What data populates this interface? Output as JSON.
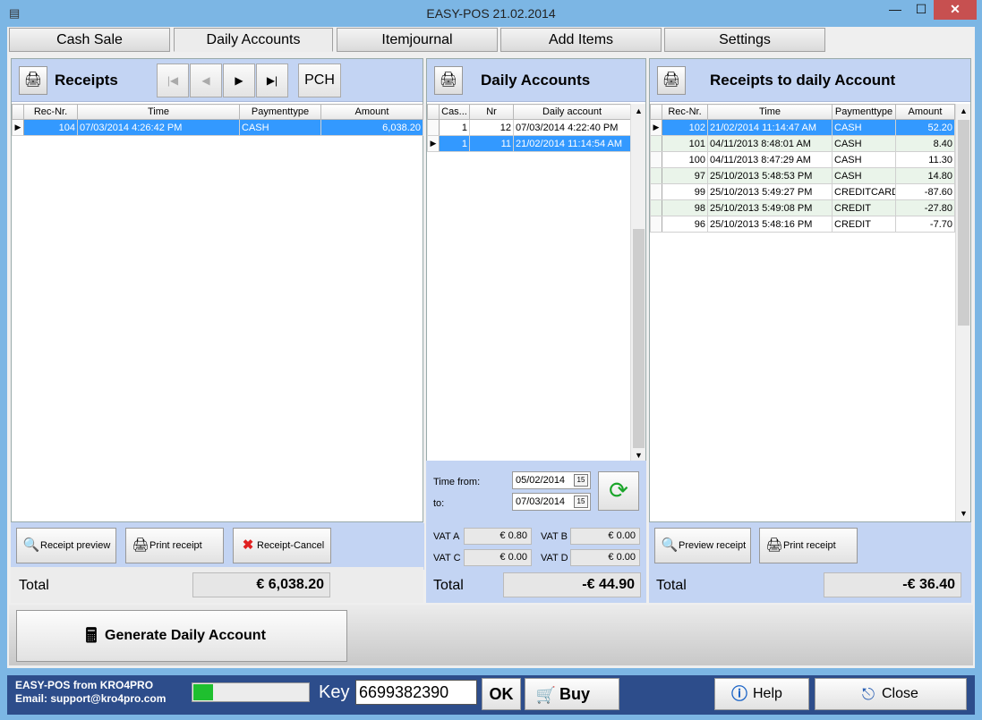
{
  "window": {
    "title": "EASY-POS 21.02.2014",
    "min": "—",
    "max": "☐",
    "close": "✕"
  },
  "tabs": [
    {
      "label": "Cash Sale"
    },
    {
      "label": "Daily Accounts"
    },
    {
      "label": "Itemjournal"
    },
    {
      "label": "Add Items"
    },
    {
      "label": "Settings"
    }
  ],
  "receipts": {
    "title": "Receipts",
    "nav": {
      "first": "|◀",
      "prev": "◀",
      "next": "▶",
      "last": "▶|",
      "pch": "PCH"
    },
    "columns": [
      "Rec-Nr.",
      "Time",
      "Paymenttype",
      "Amount"
    ],
    "rows": [
      {
        "nr": "104",
        "time": "07/03/2014 4:26:42 PM",
        "type": "CASH",
        "amount": "6,038.20"
      }
    ],
    "buttons": {
      "preview": "Receipt preview",
      "print": "Print receipt",
      "cancel": "Receipt-Cancel"
    },
    "total_label": "Total",
    "total_value": "€ 6,038.20"
  },
  "daily": {
    "title": "Daily Accounts",
    "columns": [
      "Cas...",
      "Nr",
      "Daily account"
    ],
    "rows": [
      {
        "cas": "1",
        "nr": "12",
        "account": "07/03/2014 4:22:40 PM"
      },
      {
        "cas": "1",
        "nr": "11",
        "account": "21/02/2014 11:14:54 AM"
      }
    ],
    "time_from_label": "Time from:",
    "time_from": "05/02/2014",
    "to_label": "to:",
    "to": "07/03/2014",
    "cal_glyph": "15",
    "vat": {
      "a_label": "VAT A",
      "a": "€ 0.80",
      "b_label": "VAT B",
      "b": "€ 0.00",
      "c_label": "VAT C",
      "c": "€ 0.00",
      "d_label": "VAT D",
      "d": "€ 0.00"
    },
    "total_label": "Total",
    "total_value": "-€ 44.90"
  },
  "assigned": {
    "title": "Receipts to daily Account",
    "columns": [
      "Rec-Nr.",
      "Time",
      "Paymenttype",
      "Amount"
    ],
    "rows": [
      {
        "nr": "102",
        "time": "21/02/2014 11:14:47 AM",
        "type": "CASH",
        "amount": "52.20"
      },
      {
        "nr": "101",
        "time": "04/11/2013 8:48:01 AM",
        "type": "CASH",
        "amount": "8.40"
      },
      {
        "nr": "100",
        "time": "04/11/2013 8:47:29 AM",
        "type": "CASH",
        "amount": "11.30"
      },
      {
        "nr": "97",
        "time": "25/10/2013 5:48:53 PM",
        "type": "CASH",
        "amount": "14.80"
      },
      {
        "nr": "99",
        "time": "25/10/2013 5:49:27 PM",
        "type": "CREDITCARD",
        "amount": "-87.60"
      },
      {
        "nr": "98",
        "time": "25/10/2013 5:49:08 PM",
        "type": "CREDIT",
        "amount": "-27.80"
      },
      {
        "nr": "96",
        "time": "25/10/2013 5:48:16 PM",
        "type": "CREDIT",
        "amount": "-7.70"
      }
    ],
    "buttons": {
      "preview": "Preview receipt",
      "print": "Print receipt"
    },
    "total_label": "Total",
    "total_value": "-€ 36.40"
  },
  "generate_label": "Generate Daily Account",
  "status": {
    "line1": "EASY-POS from KRO4PRO",
    "line2": "Email: support@kro4pro.com",
    "progress": 0.17,
    "key_label": "Key",
    "key_value": "6699382390",
    "ok": "OK",
    "buy": "Buy",
    "help": "Help",
    "close": "Close"
  },
  "colors": {
    "accent": "#3399ff",
    "panel_head": "#c3d4f3",
    "status": "#2d4d8b"
  }
}
